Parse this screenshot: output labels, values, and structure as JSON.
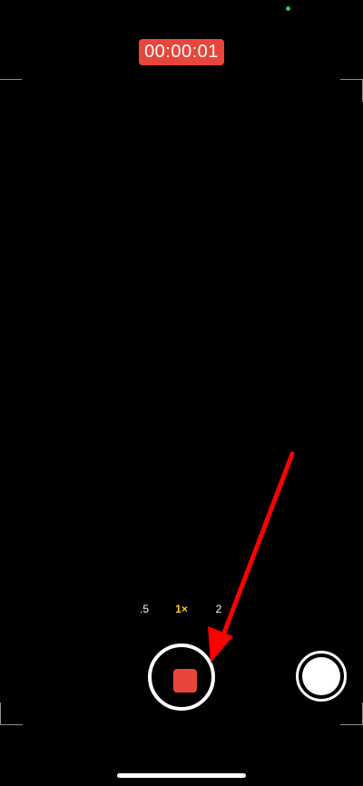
{
  "recording": {
    "timer": "00:00:01"
  },
  "zoom": {
    "options": [
      ".5",
      "1×",
      "2"
    ],
    "selected": "1×"
  },
  "colors": {
    "background": "#000000",
    "record_red": "#e8463d",
    "zoom_selected": "#ffd60a",
    "privacy_indicator": "#34c759",
    "annotation_arrow": "#ff0000"
  },
  "icons": {
    "record_button": "stop-recording-icon",
    "photo_button": "shutter-icon",
    "annotation": "red-arrow-icon"
  }
}
